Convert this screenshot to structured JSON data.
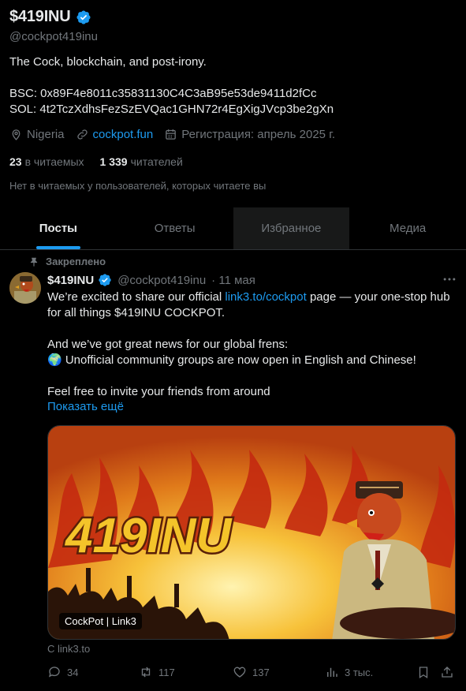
{
  "profile": {
    "display_name": "$419INU",
    "handle": "@cockpot419inu",
    "bio": "The Cock, blockchain, and post-irony.\n\nBSC: 0x89F4e8011c35831130C4C3aB95e53de9411d2fCc\nSOL: 4t2TczXdhsFezSzEVQac1GHN72r4EgXigJVcp3be2gXn",
    "location": "Nigeria",
    "website": "cockpot.fun",
    "joined": "Регистрация: апрель 2025 г.",
    "following_count": "23",
    "following_label": "в читаемых",
    "followers_count": "1 339",
    "followers_label": "читателей",
    "not_followed_note": "Нет в читаемых у пользователей, которых читаете вы"
  },
  "tabs": [
    {
      "label": "Посты"
    },
    {
      "label": "Ответы"
    },
    {
      "label": "Избранное"
    },
    {
      "label": "Медиа"
    }
  ],
  "post": {
    "pinned_label": "Закреплено",
    "author_name": "$419INU",
    "author_handle": "@cockpot419inu",
    "date": "· 11 мая",
    "line1_before": "We’re excited to share our official ",
    "line1_link": "link3.to/cockpot",
    "line1_after": " page — your one-stop hub for all things $419INU COCKPOT.",
    "line2": "And we’ve got great news for our global frens:",
    "line3": "🌍 Unofficial community groups are now open in English and Chinese!",
    "line4": "Feel free to invite your friends from around",
    "show_more": "Показать ещё",
    "card_label": "CockPot | Link3",
    "card_image_text": "419INU",
    "card_source": "С link3.to",
    "replies": "34",
    "reposts": "117",
    "likes": "137",
    "views": "3 тыс."
  },
  "colors": {
    "accent": "#1d9bf0",
    "muted": "#71767b",
    "text": "#e7e9ea",
    "background": "#000000"
  }
}
